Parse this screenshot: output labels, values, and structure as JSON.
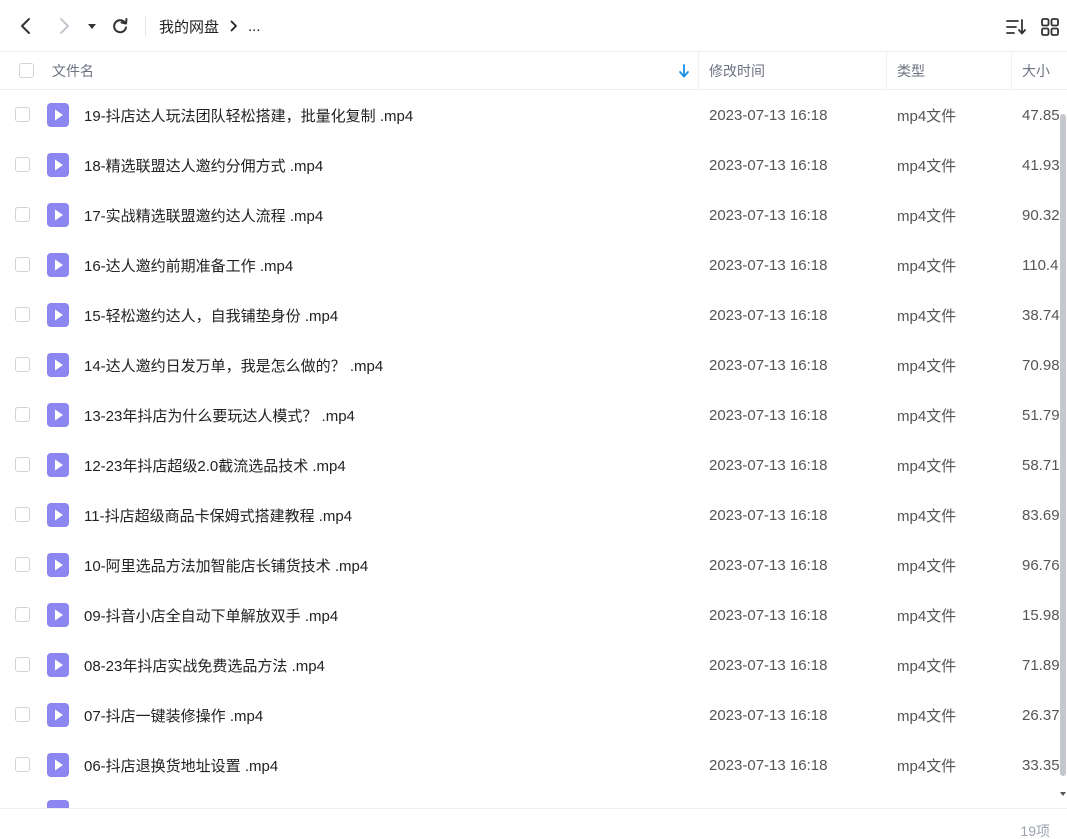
{
  "breadcrumb": {
    "root": "我的网盘",
    "more": "..."
  },
  "header": {
    "name": "文件名",
    "modified": "修改时间",
    "type": "类型",
    "size": "大小"
  },
  "icons": {
    "back": "chevron-left-icon",
    "forward": "chevron-right-icon",
    "history_dropdown": "caret-down-icon",
    "refresh": "refresh-icon",
    "sort": "sort-list-icon",
    "view": "grid-view-icon",
    "sort_direction": "arrow-down-icon",
    "file": "video-file-icon"
  },
  "colors": {
    "accent": "#1a8fe8",
    "file_icon": "#8b86f0"
  },
  "files": [
    {
      "name": "19-抖店达人玩法团队轻松搭建，批量化复制 .mp4",
      "modified": "2023-07-13 16:18",
      "type": "mp4文件",
      "size": "47.85"
    },
    {
      "name": "18-精选联盟达人邀约分佣方式 .mp4",
      "modified": "2023-07-13 16:18",
      "type": "mp4文件",
      "size": "41.93"
    },
    {
      "name": "17-实战精选联盟邀约达人流程 .mp4",
      "modified": "2023-07-13 16:18",
      "type": "mp4文件",
      "size": "90.32"
    },
    {
      "name": "16-达人邀约前期准备工作 .mp4",
      "modified": "2023-07-13 16:18",
      "type": "mp4文件",
      "size": "110.4"
    },
    {
      "name": "15-轻松邀约达人，自我铺垫身份 .mp4",
      "modified": "2023-07-13 16:18",
      "type": "mp4文件",
      "size": "38.74"
    },
    {
      "name": "14-达人邀约日发万单，我是怎么做的？ .mp4",
      "modified": "2023-07-13 16:18",
      "type": "mp4文件",
      "size": "70.98"
    },
    {
      "name": "13-23年抖店为什么要玩达人模式？ .mp4",
      "modified": "2023-07-13 16:18",
      "type": "mp4文件",
      "size": "51.79"
    },
    {
      "name": "12-23年抖店超级2.0截流选品技术 .mp4",
      "modified": "2023-07-13 16:18",
      "type": "mp4文件",
      "size": "58.71"
    },
    {
      "name": "11-抖店超级商品卡保姆式搭建教程 .mp4",
      "modified": "2023-07-13 16:18",
      "type": "mp4文件",
      "size": "83.69"
    },
    {
      "name": "10-阿里选品方法加智能店长铺货技术 .mp4",
      "modified": "2023-07-13 16:18",
      "type": "mp4文件",
      "size": "96.76"
    },
    {
      "name": "09-抖音小店全自动下单解放双手 .mp4",
      "modified": "2023-07-13 16:18",
      "type": "mp4文件",
      "size": "15.98"
    },
    {
      "name": "08-23年抖店实战免费选品方法 .mp4",
      "modified": "2023-07-13 16:18",
      "type": "mp4文件",
      "size": "71.89"
    },
    {
      "name": "07-抖店一键装修操作 .mp4",
      "modified": "2023-07-13 16:18",
      "type": "mp4文件",
      "size": "26.37"
    },
    {
      "name": "06-抖店退换货地址设置 .mp4",
      "modified": "2023-07-13 16:18",
      "type": "mp4文件",
      "size": "33.35"
    }
  ],
  "footer": {
    "count": "19项"
  }
}
